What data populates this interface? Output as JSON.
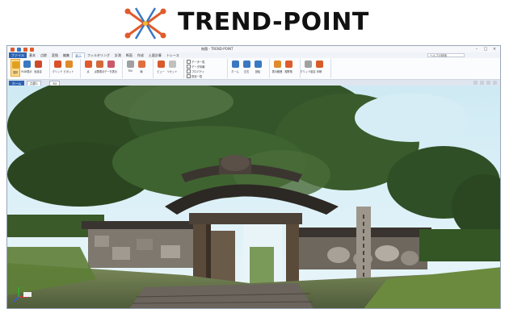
{
  "brand": {
    "name": "TREND-POINT"
  },
  "window": {
    "title": "無題 - TREND-POINT"
  },
  "ribbon_tabs": [
    "ファイル",
    "基本",
    "点群",
    "変換",
    "編集",
    "表示",
    "フィルタリング",
    "計測",
    "断面",
    "作成",
    "土量計算",
    "トレース"
  ],
  "active_tab": "表示",
  "help_search": {
    "placeholder": "ヘルプの検索"
  },
  "ribbon": {
    "buttons": [
      {
        "label": "選択",
        "color": "#e0a020"
      },
      {
        "label": "RGB表示",
        "color": "#3a78c2"
      },
      {
        "label": "色設定",
        "color": "#cc4a2a"
      },
      {
        "label": "グリッド",
        "color": "#d9522b"
      },
      {
        "label": "ピボット",
        "color": "#e08a2a"
      },
      {
        "label": "点",
        "color": "#e05b2b"
      },
      {
        "label": "点群表示",
        "color": "#d46a3a"
      },
      {
        "label": "データ表示",
        "color": "#c85a6a"
      },
      {
        "label": "TIN",
        "color": "#a0a0a0"
      },
      {
        "label": "線",
        "color": "#e07040"
      },
      {
        "label": "ビュー",
        "color": "#d95a2a"
      },
      {
        "label": "リセット",
        "color": "#c0c0c0"
      },
      {
        "label": "ホーム",
        "color": "#3a78c2"
      },
      {
        "label": "左右",
        "color": "#3a78c2"
      },
      {
        "label": "回転",
        "color": "#3a78c2"
      },
      {
        "label": "表示範囲",
        "color": "#e08a2a"
      },
      {
        "label": "視野角",
        "color": "#e05b2b"
      },
      {
        "label": "グリッド設定",
        "color": "#a0a0a0"
      },
      {
        "label": "印刷",
        "color": "#d95a2a"
      }
    ],
    "checks": [
      "データ一覧",
      "データ情報",
      "プロパティ",
      "別窓一覧"
    ]
  },
  "doc_tabs": [
    "ホーム",
    "点群1",
    "3D"
  ],
  "scene": {
    "sky": "#d8eef6",
    "tree": "#2c4a24",
    "roof": "#3b3530",
    "wood": "#5a4a3a",
    "stone": "#8a8480",
    "grass": "#6a8a3a"
  },
  "monument_text": "史跡 ..."
}
